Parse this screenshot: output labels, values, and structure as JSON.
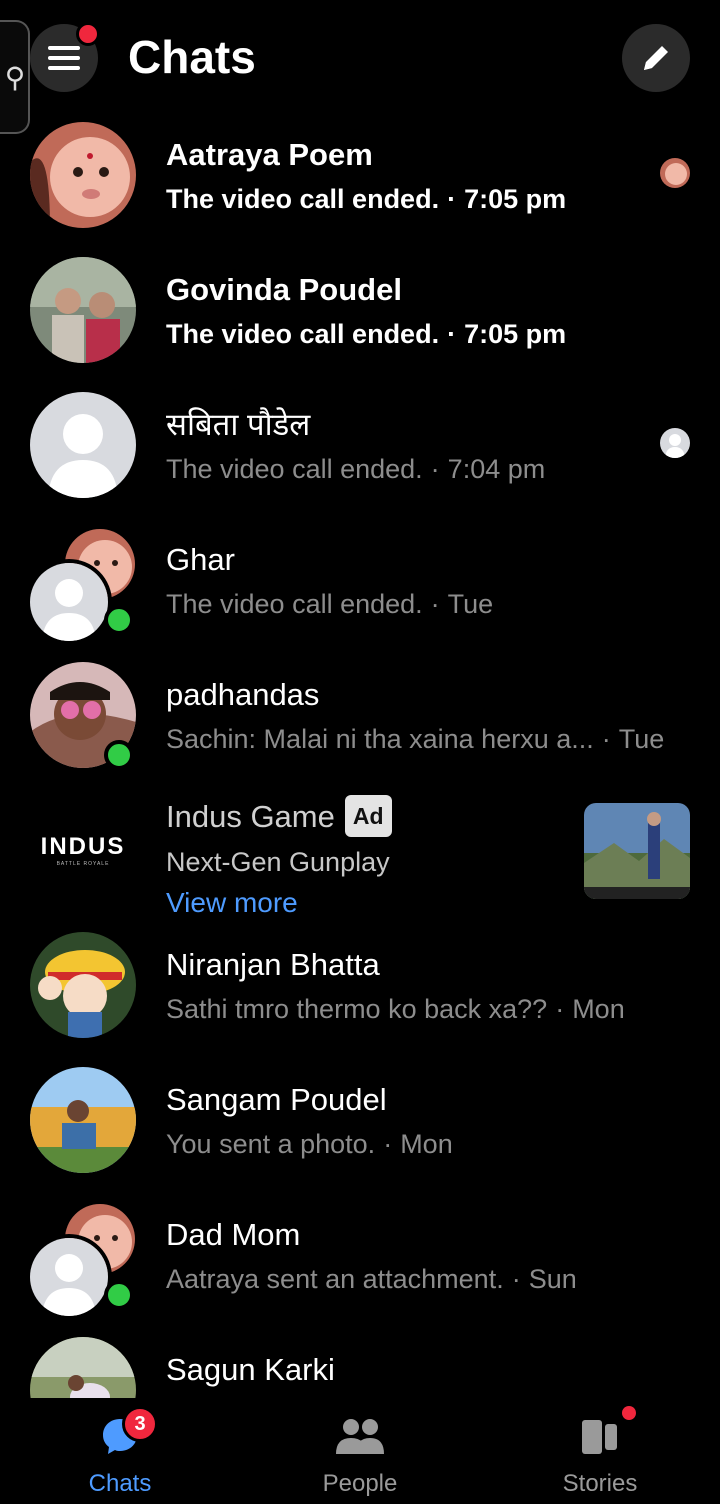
{
  "header": {
    "title": "Chats",
    "menu_icon": "hamburger-icon",
    "compose_icon": "pencil-icon",
    "accessibility_icon": "accessibility-icon"
  },
  "chats": [
    {
      "name": "Aatraya Poem",
      "message": "The video call ended.",
      "time": "7:05 pm",
      "unread": true
    },
    {
      "name": "Govinda Poudel",
      "message": "The video call ended.",
      "time": "7:05 pm",
      "unread": true
    },
    {
      "name": "सबिता पौडेल",
      "message": "The video call ended.",
      "time": "7:04 pm",
      "unread": false
    },
    {
      "name": "Ghar",
      "message": "The video call ended.",
      "time": "Tue",
      "unread": false,
      "online": true
    },
    {
      "name": "padhandas",
      "message": "Sachin: Malai ni tha xaina herxu a...",
      "time": "Tue",
      "unread": false,
      "online": true
    },
    {
      "name": "Niranjan Bhatta",
      "message": "Sathi tmro thermo ko back xa??",
      "time": "Mon",
      "unread": false
    },
    {
      "name": "Sangam Poudel",
      "message": "You sent a photo.",
      "time": "Mon",
      "unread": false
    },
    {
      "name": "Dad Mom",
      "message": "Aatraya sent an attachment.",
      "time": "Sun",
      "unread": false,
      "online": true
    },
    {
      "name": "Sagun Karki",
      "message": "",
      "time": "",
      "unread": false
    }
  ],
  "ad": {
    "name": "Indus Game",
    "badge": "Ad",
    "tagline": "Next-Gen Gunplay",
    "cta": "View more",
    "logo_text": "INDUS",
    "logo_sub": "BATTLE ROYALE"
  },
  "tabs": [
    {
      "label": "Chats",
      "icon": "chat-bubble-icon",
      "badge": "3",
      "active": true
    },
    {
      "label": "People",
      "icon": "people-icon",
      "active": false
    },
    {
      "label": "Stories",
      "icon": "stories-icon",
      "active": false
    }
  ],
  "colors": {
    "accent": "#4e9bff",
    "online": "#31cc46",
    "badge": "#f0273d"
  }
}
